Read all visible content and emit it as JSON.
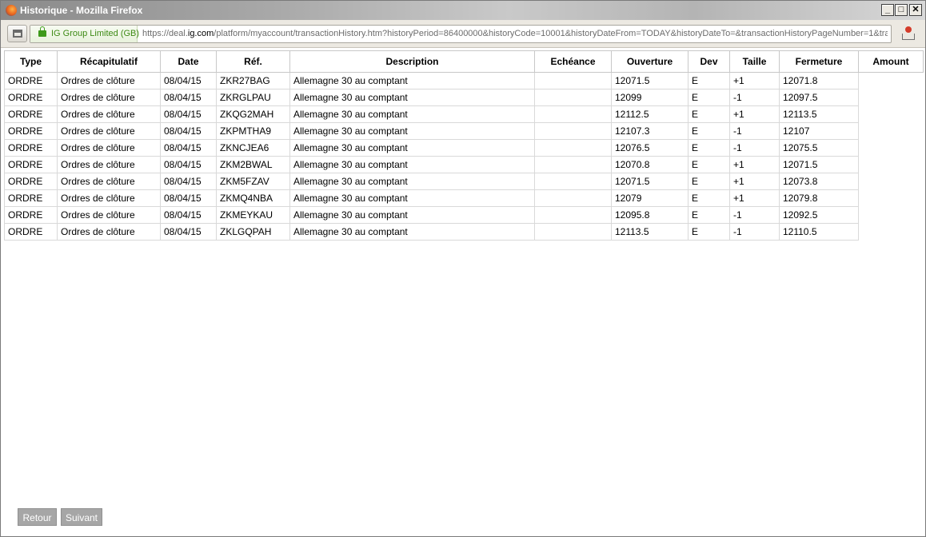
{
  "window": {
    "title": "Historique - Mozilla Firefox",
    "minimize_label": "_",
    "maximize_label": "□",
    "close_label": "✕"
  },
  "urlbar": {
    "identity": "IG Group Limited (GB)",
    "url_prefix": "https://deal.",
    "url_domain": "ig.com",
    "url_rest": "/platform/myaccount/transactionHistory.htm?historyPeriod=86400000&historyCode=10001&historyDateFrom=TODAY&historyDateTo=&transactionHistoryPageNumber=1&tra"
  },
  "table": {
    "headers": [
      "Type",
      "Récapitulatif",
      "Date",
      "Réf.",
      "Description",
      "Echéance",
      "Ouverture",
      "Dev",
      "Taille",
      "Fermeture",
      "Amount"
    ],
    "rows": [
      [
        "ORDRE",
        "Ordres de clôture",
        "08/04/15",
        "ZKR27BAG",
        "Allemagne 30 au comptant",
        "",
        "12071.5",
        "E",
        "+1",
        "12071.8",
        ""
      ],
      [
        "ORDRE",
        "Ordres de clôture",
        "08/04/15",
        "ZKRGLPAU",
        "Allemagne 30 au comptant",
        "",
        "12099",
        "E",
        "-1",
        "12097.5",
        ""
      ],
      [
        "ORDRE",
        "Ordres de clôture",
        "08/04/15",
        "ZKQG2MAH",
        "Allemagne 30 au comptant",
        "",
        "12112.5",
        "E",
        "+1",
        "12113.5",
        ""
      ],
      [
        "ORDRE",
        "Ordres de clôture",
        "08/04/15",
        "ZKPMTHA9",
        "Allemagne 30 au comptant",
        "",
        "12107.3",
        "E",
        "-1",
        "12107",
        ""
      ],
      [
        "ORDRE",
        "Ordres de clôture",
        "08/04/15",
        "ZKNCJEA6",
        "Allemagne 30 au comptant",
        "",
        "12076.5",
        "E",
        "-1",
        "12075.5",
        ""
      ],
      [
        "ORDRE",
        "Ordres de clôture",
        "08/04/15",
        "ZKM2BWAL",
        "Allemagne 30 au comptant",
        "",
        "12070.8",
        "E",
        "+1",
        "12071.5",
        ""
      ],
      [
        "ORDRE",
        "Ordres de clôture",
        "08/04/15",
        "ZKM5FZAV",
        "Allemagne 30 au comptant",
        "",
        "12071.5",
        "E",
        "+1",
        "12073.8",
        ""
      ],
      [
        "ORDRE",
        "Ordres de clôture",
        "08/04/15",
        "ZKMQ4NBA",
        "Allemagne 30 au comptant",
        "",
        "12079",
        "E",
        "+1",
        "12079.8",
        ""
      ],
      [
        "ORDRE",
        "Ordres de clôture",
        "08/04/15",
        "ZKMEYKAU",
        "Allemagne 30 au comptant",
        "",
        "12095.8",
        "E",
        "-1",
        "12092.5",
        ""
      ],
      [
        "ORDRE",
        "Ordres de clôture",
        "08/04/15",
        "ZKLGQPAH",
        "Allemagne 30 au comptant",
        "",
        "12113.5",
        "E",
        "-1",
        "12110.5",
        ""
      ]
    ]
  },
  "pager": {
    "back_label": "Retour",
    "next_label": "Suivant"
  }
}
